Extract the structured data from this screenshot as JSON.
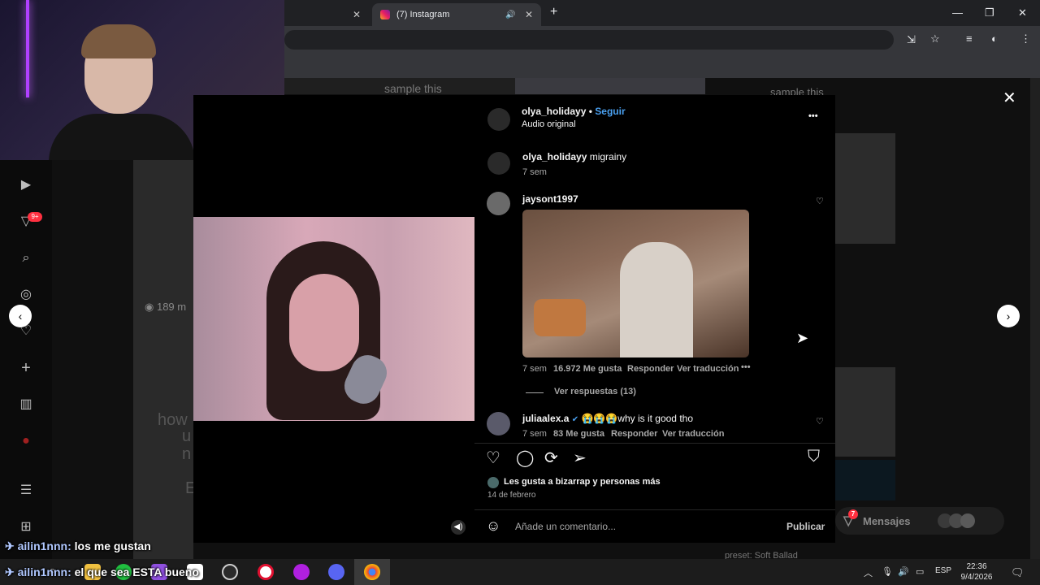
{
  "browser": {
    "tabs": [
      {
        "label": ""
      },
      {
        "label": "(7) Instagram"
      }
    ],
    "new_tab_symbol": "+",
    "window_controls": [
      "—",
      "❐",
      "✕"
    ]
  },
  "background_feed": {
    "text_top_left": "sample this",
    "text_top_right": "sample this",
    "views": "189 m",
    "overlay_text_1": "how",
    "overlay_text_2": "u",
    "overlay_text_3": "n",
    "overlay_text_4": "E",
    "bottom_text": "preset:   Soft Ballad"
  },
  "nav": {
    "notification_badge": "9+",
    "icons": [
      "reels-icon",
      "activity-icon",
      "search-icon",
      "explore-icon",
      "heart-icon",
      "create-icon",
      "insights-icon",
      "profile-icon",
      "menu-icon",
      "threads-icon"
    ]
  },
  "post": {
    "author": "olya_holidayy",
    "separator": "•",
    "follow_label": "Seguir",
    "audio": "Audio original",
    "more": "•••",
    "caption_user": "olya_holidayy",
    "caption_text": "migrainy",
    "caption_time": "7 sem",
    "comments": [
      {
        "user": "jaysont1997",
        "time": "7 sem",
        "likes": "16.972 Me gusta",
        "reply": "Responder",
        "translate": "Ver traducción",
        "more": "•••",
        "view_replies": "Ver respuestas (13)"
      },
      {
        "user": "juliaalex.a",
        "verified": "✔",
        "text": "😭😭😭why is it good tho",
        "time": "7 sem",
        "likes": "83 Me gusta",
        "reply": "Responder",
        "translate": "Ver traducción"
      }
    ],
    "liked_by_prefix": "Les gusta a ",
    "liked_by_user": "bizarrap",
    "liked_by_suffix": " y personas más",
    "date": "14 de febrero",
    "comment_placeholder": "Añade un comentario...",
    "publish_label": "Publicar",
    "emoji_icon": "☺"
  },
  "messages": {
    "label": "Mensajes",
    "badge": "7"
  },
  "chat": [
    {
      "user": "ailin1nnn",
      "text": "los me gustan"
    },
    {
      "user": "ailin1nnn",
      "text": "el que sea ESTA bueno"
    }
  ],
  "taskbar": {
    "tray_language": "ESP",
    "time": "22:36",
    "date": "9/4/2026"
  },
  "colors": {
    "accent": "#4aa0f0",
    "background": "#000000",
    "chrome": "#202124"
  }
}
